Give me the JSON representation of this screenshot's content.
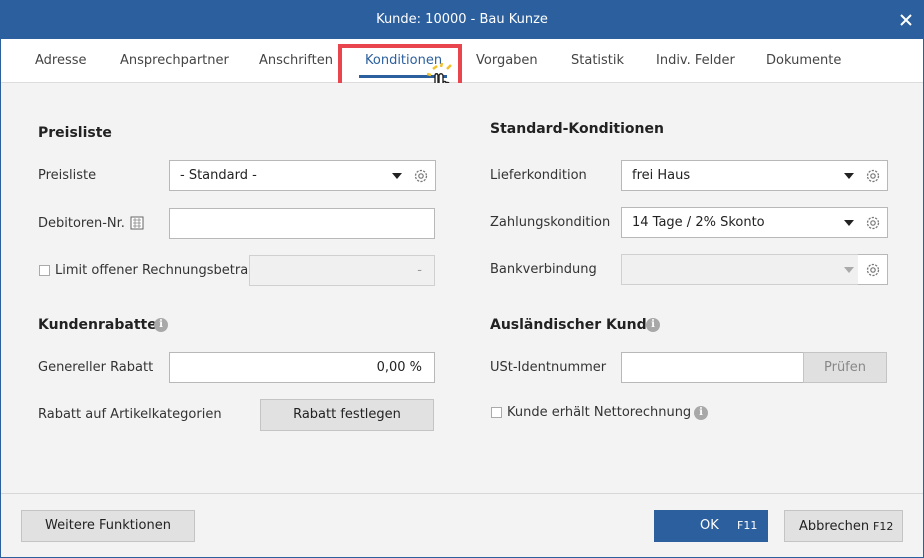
{
  "window": {
    "title": "Kunde: 10000 - Bau Kunze"
  },
  "tabs": [
    {
      "label": "Adresse"
    },
    {
      "label": "Ansprechpartner"
    },
    {
      "label": "Anschriften"
    },
    {
      "label": "Konditionen"
    },
    {
      "label": "Vorgaben"
    },
    {
      "label": "Statistik"
    },
    {
      "label": "Indiv. Felder"
    },
    {
      "label": "Dokumente"
    }
  ],
  "active_tab": "Konditionen",
  "preisliste": {
    "section_title": "Preisliste",
    "preisliste_label": "Preisliste",
    "preisliste_value": "- Standard -",
    "debitor_label": "Debitoren-Nr.",
    "debitor_value": "",
    "limit_label": "Limit offener Rechnungsbetrag",
    "limit_value": "-"
  },
  "rabatte": {
    "section_title": "Kundenrabatte",
    "general_label": "Genereller Rabatt",
    "general_value": "0,00 %",
    "artikel_label": "Rabatt auf Artikelkategorien",
    "artikel_button": "Rabatt festlegen"
  },
  "standard": {
    "section_title": "Standard-Konditionen",
    "liefer_label": "Lieferkondition",
    "liefer_value": "frei Haus",
    "zahlung_label": "Zahlungskondition",
    "zahlung_value": "14 Tage / 2% Skonto",
    "bank_label": "Bankverbindung",
    "bank_value": ""
  },
  "ausland": {
    "section_title": "Ausländischer Kunde",
    "ust_label": "USt-Identnummer",
    "ust_value": "",
    "pruefen_button": "Prüfen",
    "netto_label": "Kunde erhält Nettorechnung"
  },
  "footer": {
    "weitere_label": "Weitere Funktionen",
    "ok_label": "OK",
    "ok_shortcut": "F11",
    "abbrechen_label": "Abbrechen",
    "abbrechen_shortcut": "F12"
  },
  "colors": {
    "titlebar": "#2b5f9e",
    "highlight": "#e8454f",
    "accent": "#2b5f9e"
  }
}
